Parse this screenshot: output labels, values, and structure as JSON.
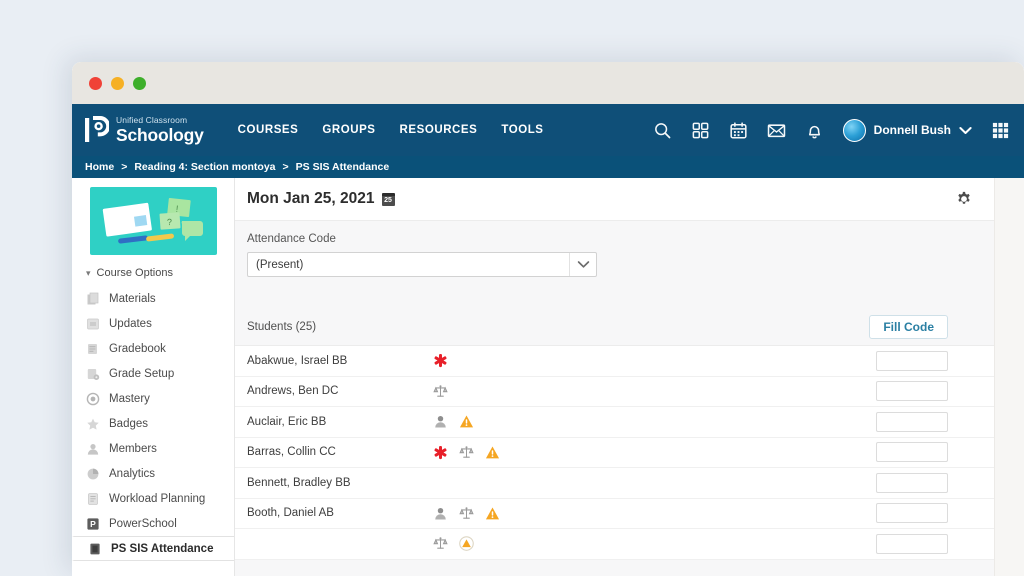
{
  "window": {
    "traffic_lights": [
      "close",
      "minimize",
      "zoom"
    ],
    "colors": {
      "titlebar": "#e8e6e1",
      "navy": "#0f4f78",
      "breadcrumb": "#0a5179",
      "accent_link": "#2a7fa3",
      "page_bg": "#e9eef4",
      "thumb_teal": "#2fd0c5"
    }
  },
  "header": {
    "brand_top": "Unified Classroom",
    "brand_main": "Schoology",
    "menu": [
      {
        "label": "COURSES"
      },
      {
        "label": "GROUPS"
      },
      {
        "label": "RESOURCES"
      },
      {
        "label": "TOOLS"
      }
    ],
    "icons": [
      "search-icon",
      "grid-apps-icon",
      "calendar-icon",
      "envelope-icon",
      "bell-icon"
    ],
    "user_name": "Donnell Bush",
    "user_chevron": "chevron-down-icon",
    "app_launcher": "app-launcher-icon"
  },
  "breadcrumb": {
    "separator": ">",
    "items": [
      {
        "label": "Home"
      },
      {
        "label": "Reading 4: Section montoya"
      },
      {
        "label": "PS SIS Attendance"
      }
    ]
  },
  "sidebar": {
    "course_options_label": "Course Options",
    "items": [
      {
        "label": "Materials",
        "icon": "materials-icon",
        "active": false
      },
      {
        "label": "Updates",
        "icon": "updates-icon",
        "active": false
      },
      {
        "label": "Gradebook",
        "icon": "gradebook-icon",
        "active": false
      },
      {
        "label": "Grade Setup",
        "icon": "grade-setup-icon",
        "active": false
      },
      {
        "label": "Mastery",
        "icon": "mastery-icon",
        "active": false
      },
      {
        "label": "Badges",
        "icon": "badges-icon",
        "active": false
      },
      {
        "label": "Members",
        "icon": "members-icon",
        "active": false
      },
      {
        "label": "Analytics",
        "icon": "analytics-icon",
        "active": false
      },
      {
        "label": "Workload Planning",
        "icon": "workload-icon",
        "active": false
      },
      {
        "label": "PowerSchool",
        "icon": "powerschool-icon",
        "active": false
      },
      {
        "label": "PS SIS Attendance",
        "icon": "ps-sis-icon",
        "active": true
      }
    ]
  },
  "main": {
    "date_title": "Mon Jan 25, 2021",
    "calendar_day": "25",
    "gear": "settings-gear-icon",
    "attendance_code_label": "Attendance Code",
    "attendance_code_value": "(Present)",
    "attendance_code_chevron": "chevron-down-icon",
    "students_label": "Students (25)",
    "fill_code_label": "Fill Code",
    "code_input_placeholder": "",
    "students": [
      {
        "name": "Abakwue, Israel BB",
        "flags": [
          "medical"
        ]
      },
      {
        "name": "Andrews, Ben DC",
        "flags": [
          "legal"
        ]
      },
      {
        "name": "Auclair, Eric BB",
        "flags": [
          "person",
          "alert"
        ]
      },
      {
        "name": "Barras, Collin CC",
        "flags": [
          "medical",
          "legal",
          "alert"
        ]
      },
      {
        "name": "Bennett, Bradley BB",
        "flags": []
      },
      {
        "name": "Booth, Daniel AB",
        "flags": [
          "person",
          "legal",
          "alert"
        ]
      },
      {
        "name": "",
        "flags": [
          "legal",
          "alert-circle"
        ]
      }
    ]
  }
}
